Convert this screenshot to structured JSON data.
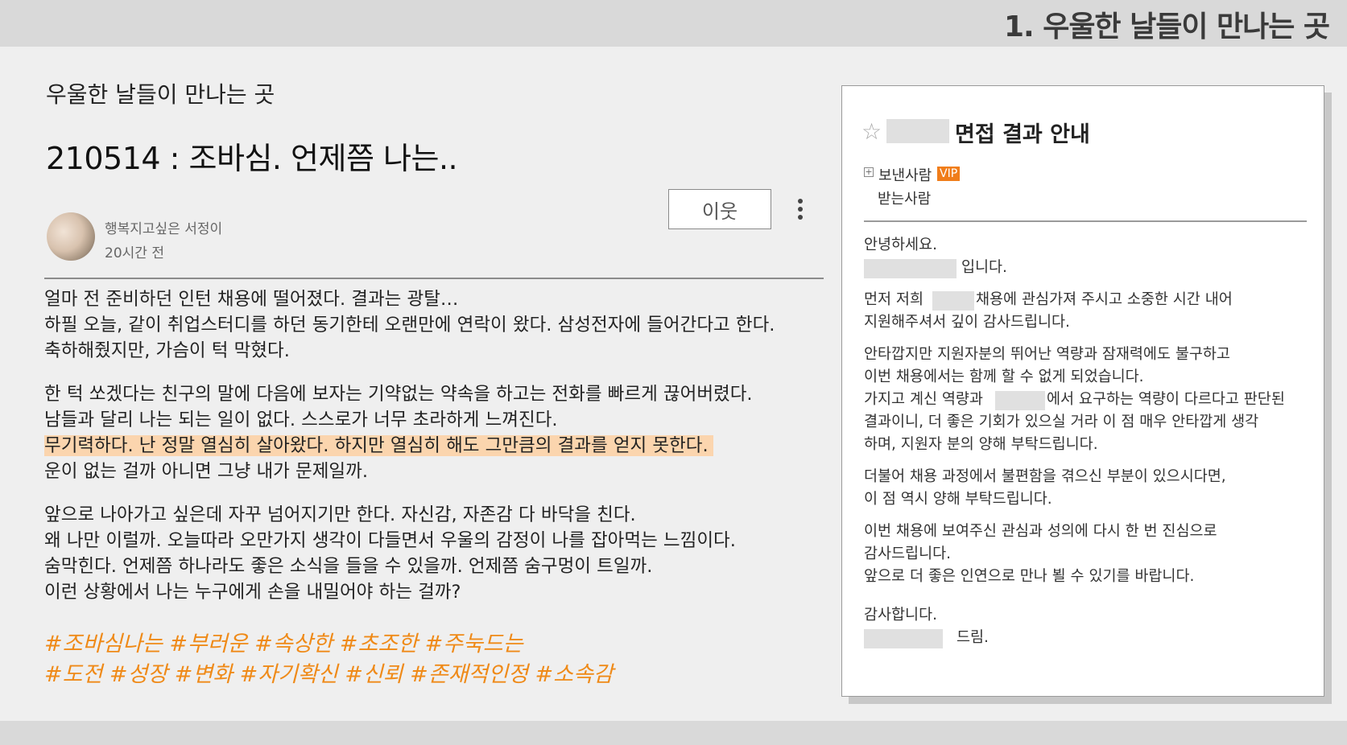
{
  "slide": {
    "title": "1. 우울한 날들이 만나는 곳"
  },
  "post": {
    "blog_name": "우울한 날들이 만나는 곳",
    "title": "210514 : 조바심. 언제쯤 나는..",
    "author": "행복지고싶은 서정이",
    "time": "20시간 전",
    "neighbor_label": "이웃",
    "paragraph1": [
      "얼마 전 준비하던 인턴 채용에 떨어졌다. 결과는 광탈…",
      "하필 오늘, 같이 취업스터디를 하던 동기한테 오랜만에 연락이 왔다. 삼성전자에 들어간다고 한다.",
      "축하해줬지만, 가슴이 턱 막혔다."
    ],
    "paragraph2": [
      "한 턱 쏘겠다는 친구의 말에 다음에 보자는 기약없는 약속을 하고는 전화를 빠르게 끊어버렸다.",
      "남들과 달리 나는 되는 일이 없다. 스스로가 너무 초라하게 느껴진다.",
      "무기력하다. 난 정말 열심히 살아왔다. 하지만 열심히 해도 그만큼의 결과를 얻지 못한다.",
      "운이 없는 걸까 아니면 그냥 내가 문제일까."
    ],
    "paragraph3": [
      "앞으로 나아가고 싶은데 자꾸 넘어지기만 한다. 자신감, 자존감 다 바닥을 친다.",
      "왜 나만 이럴까. 오늘따라 오만가지 생각이 다들면서 우울의 감정이 나를 잡아먹는 느낌이다.",
      "숨막힌다. 언제쯤 하나라도 좋은 소식을 들을 수 있을까. 언제쯤 숨구멍이 트일까.",
      "이런 상황에서 나는 누구에게 손을 내밀어야 하는 걸까?"
    ],
    "tags_line1": "#조바심나는 #부러운 #속상한 #초조한 #주눅드는",
    "tags_line2": "#도전 #성장 #변화 #자기확신 #신뢰 #존재적인정 #소속감",
    "highlight_color": "#fbd5ae",
    "tag_color": "#ef8a18"
  },
  "email": {
    "subject": "면접 결과 안내",
    "sender_label": "보낸사람",
    "vip_badge": "VIP",
    "receiver_label": "받는사람",
    "greeting": "안녕하세요.",
    "intro_suffix": "입니다.",
    "p1_prefix": "먼저 저희",
    "p1_suffix": "채용에 관심가져 주시고 소중한 시간 내어",
    "p1_line2": "지원해주셔서 깊이 감사드립니다.",
    "p2_line1": "안타깝지만 지원자분의 뛰어난 역량과 잠재력에도 불구하고",
    "p2_line2": "이번 채용에서는 함께 할 수 없게 되었습니다.",
    "p2_line3_prefix": "가지고 계신 역량과",
    "p2_line3_suffix": "에서 요구하는 역량이 다르다고 판단된",
    "p2_line4": "결과이니, 더 좋은 기회가 있으실 거라 이 점 매우 안타깝게 생각",
    "p2_line5": "하며, 지원자 분의 양해 부탁드립니다.",
    "p3_line1": "더불어 채용 과정에서 불편함을 겪으신 부분이 있으시다면,",
    "p3_line2": "이 점 역시 양해 부탁드립니다.",
    "p4_line1": "이번 채용에 보여주신 관심과 성의에 다시 한 번 진심으로",
    "p4_line2": "감사드립니다.",
    "p4_line3": "앞으로 더 좋은 인연으로 만나 뵐 수 있기를 바랍니다.",
    "closing": "감사합니다.",
    "sign_suffix": "드림.",
    "vip_color": "#f07d1a"
  }
}
